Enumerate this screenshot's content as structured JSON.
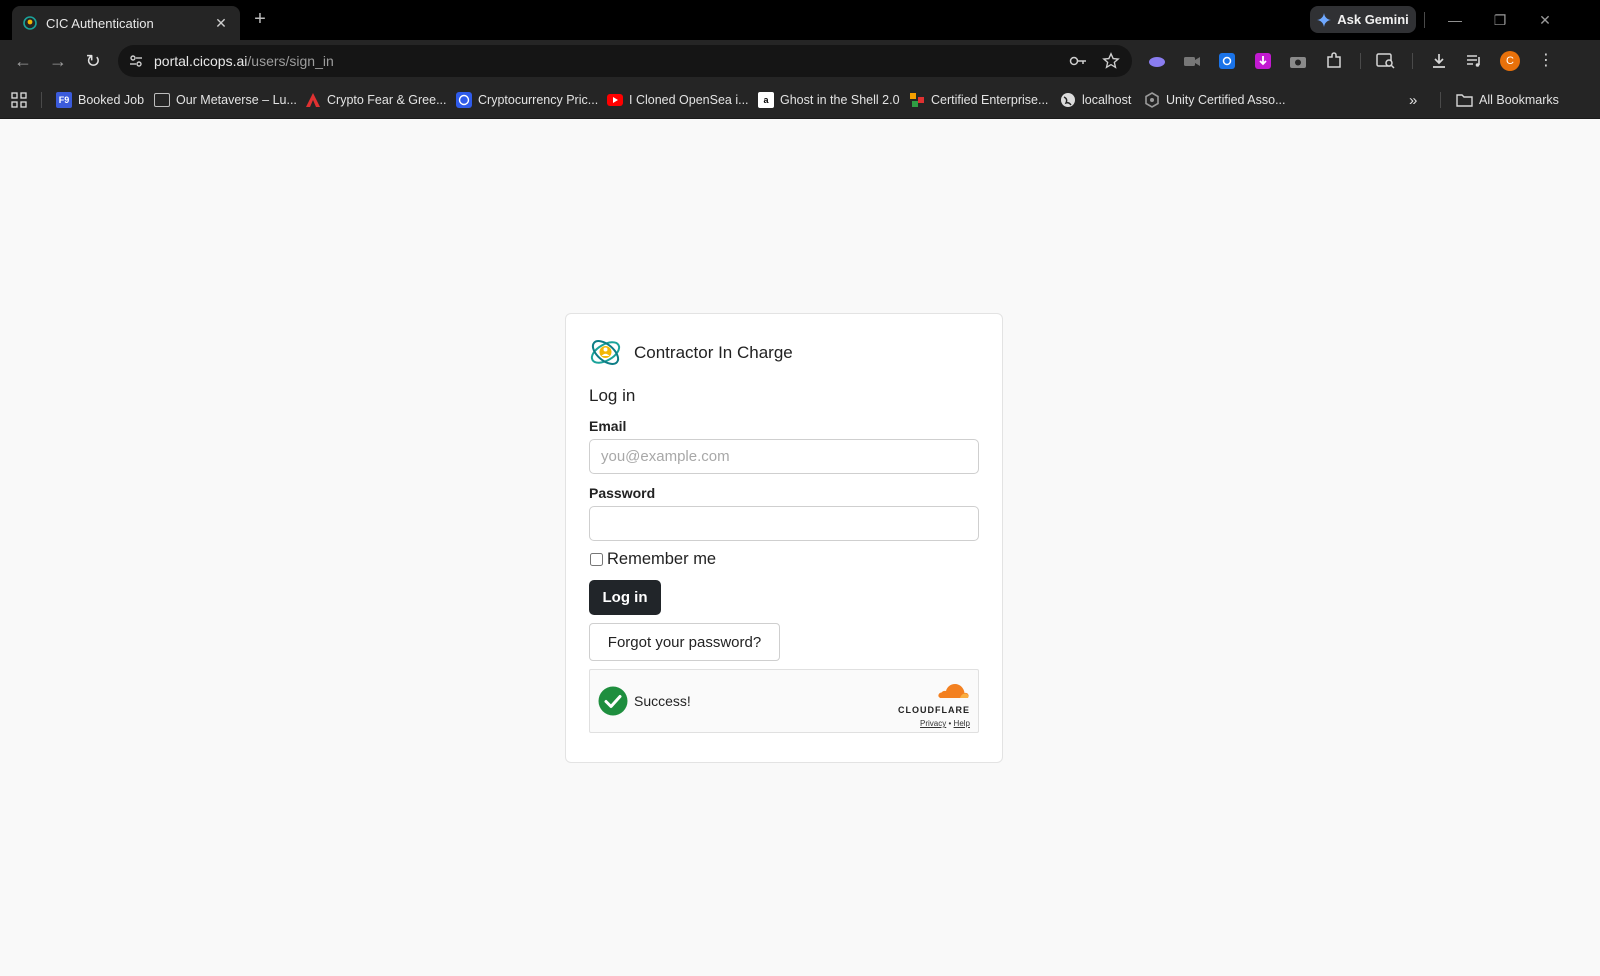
{
  "browser": {
    "tab_title": "CIC Authentication",
    "tab_close": "✕",
    "new_tab": "+",
    "ask_gemini": "Ask Gemini",
    "url_host": "portal.cicops.ai",
    "url_path": "/users/sign_in",
    "profile_initial": "C",
    "bookmarks": [
      {
        "label": "Booked Job",
        "icon_text": "F9",
        "color": "#3b5bdb"
      },
      {
        "label": "Our Metaverse – Lu...",
        "icon_text": "",
        "color": "#5a5a5a"
      },
      {
        "label": "Crypto Fear & Gree...",
        "icon_text": "",
        "color": "#e03131"
      },
      {
        "label": "Cryptocurrency Pric...",
        "icon_text": "",
        "color": "#2f5bea"
      },
      {
        "label": "I Cloned OpenSea i...",
        "icon_text": "",
        "color": "#ff0000"
      },
      {
        "label": "Ghost in the Shell 2.0",
        "icon_text": "a",
        "color": "#ffffff"
      },
      {
        "label": "Certified Enterprise...",
        "icon_text": "",
        "color": "#f59f00"
      },
      {
        "label": "localhost",
        "icon_text": "",
        "color": "#dcdcdc"
      },
      {
        "label": "Unity Certified Asso...",
        "icon_text": "",
        "color": "#9a9a9a"
      }
    ],
    "all_bookmarks": "All Bookmarks"
  },
  "page": {
    "brand_name": "Contractor In Charge",
    "heading": "Log in",
    "email_label": "Email",
    "email_placeholder": "you@example.com",
    "email_value": "",
    "password_label": "Password",
    "password_value": "",
    "remember_label": "Remember me",
    "remember_checked": false,
    "login_button": "Log in",
    "forgot_button": "Forgot your password?",
    "turnstile": {
      "status": "Success!",
      "brand": "CLOUDFLARE",
      "privacy": "Privacy",
      "separator": "•",
      "help": "Help"
    }
  },
  "colors": {
    "chrome_bg": "#252525",
    "page_bg": "#f9f9f9",
    "primary_button": "#212529",
    "success_green": "#1e8e3e",
    "cloudflare_orange": "#f38020"
  }
}
